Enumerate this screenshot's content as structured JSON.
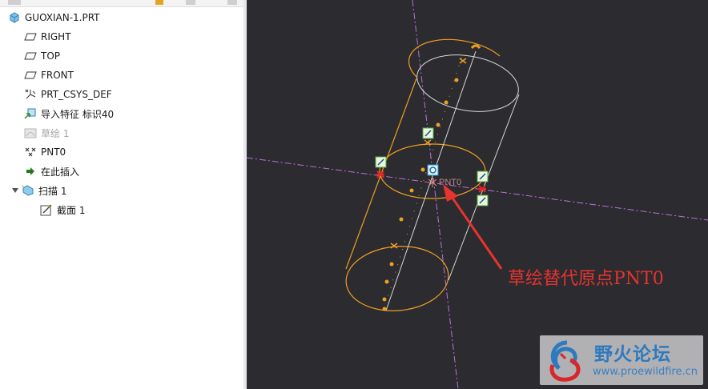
{
  "model_tree": {
    "items": [
      {
        "label": "GUOXIAN-1.PRT",
        "icon": "part-icon",
        "dim": false
      },
      {
        "label": "RIGHT",
        "icon": "datum-plane-icon",
        "dim": false
      },
      {
        "label": "TOP",
        "icon": "datum-plane-icon",
        "dim": false
      },
      {
        "label": "FRONT",
        "icon": "datum-plane-icon",
        "dim": false
      },
      {
        "label": "PRT_CSYS_DEF",
        "icon": "csys-icon",
        "dim": false
      },
      {
        "label": "导入特征 标识40",
        "icon": "import-feature-icon",
        "dim": false
      },
      {
        "label": "草绘 1",
        "icon": "sketch-icon",
        "dim": true
      },
      {
        "label": "PNT0",
        "icon": "datum-point-icon",
        "dim": false
      },
      {
        "label": "在此插入",
        "icon": "insert-here-arrow-icon",
        "dim": false
      },
      {
        "label": "扫描 1",
        "icon": "sweep-feature-icon",
        "dim": false
      },
      {
        "label": "截面 1",
        "icon": "section-sketch-icon",
        "dim": false
      }
    ]
  },
  "viewport": {
    "point_label": "PNT0",
    "annotation": "草绘替代原点PNT0"
  },
  "watermark": {
    "title": "野火论坛",
    "url": "www.proewildfire.cn"
  },
  "colors": {
    "background": "#2b2b30",
    "geometry": "#f0a020",
    "annotation": "#e8332e",
    "axis": "#c070d8"
  }
}
